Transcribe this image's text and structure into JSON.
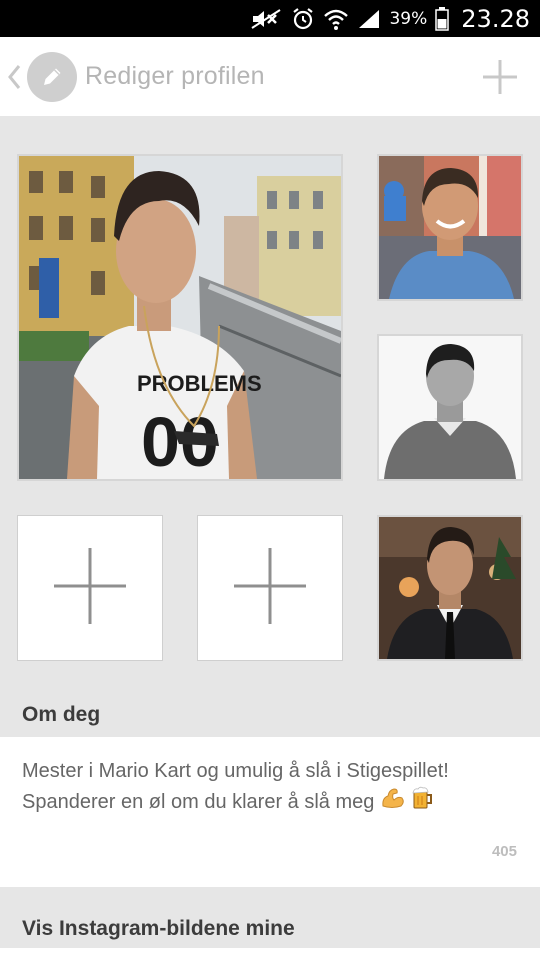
{
  "status_bar": {
    "battery_percent": "39%",
    "time": "23.28",
    "icons": [
      "mute-icon",
      "alarm-icon",
      "wifi-icon",
      "signal-icon",
      "battery-icon"
    ]
  },
  "header": {
    "title": "Rediger profilen",
    "back_icon": "chevron-left-icon",
    "avatar_icon": "pencil-icon",
    "action_icon": "plus-icon"
  },
  "photos": {
    "main": "photo-man-problems-shirt",
    "side": [
      "photo-smiling-outdoor",
      "photo-black-white-sweater",
      "photo-suit-tie"
    ],
    "empty_slots": 2,
    "add_icon": "plus-icon"
  },
  "about": {
    "heading": "Om deg",
    "text": "Mester i Mario Kart og umulig å slå i Stigespillet! Spanderer en øl om du klarer å slå meg",
    "emojis": [
      "flexed-biceps-icon",
      "beer-mug-icon"
    ],
    "char_count": "405"
  },
  "instagram": {
    "heading": "Vis Instagram-bildene mine"
  },
  "colors": {
    "header_bg": "#ffffff",
    "page_bg": "#e6e6e6",
    "title_gray": "#b5b5b5",
    "text_gray": "#666666"
  }
}
